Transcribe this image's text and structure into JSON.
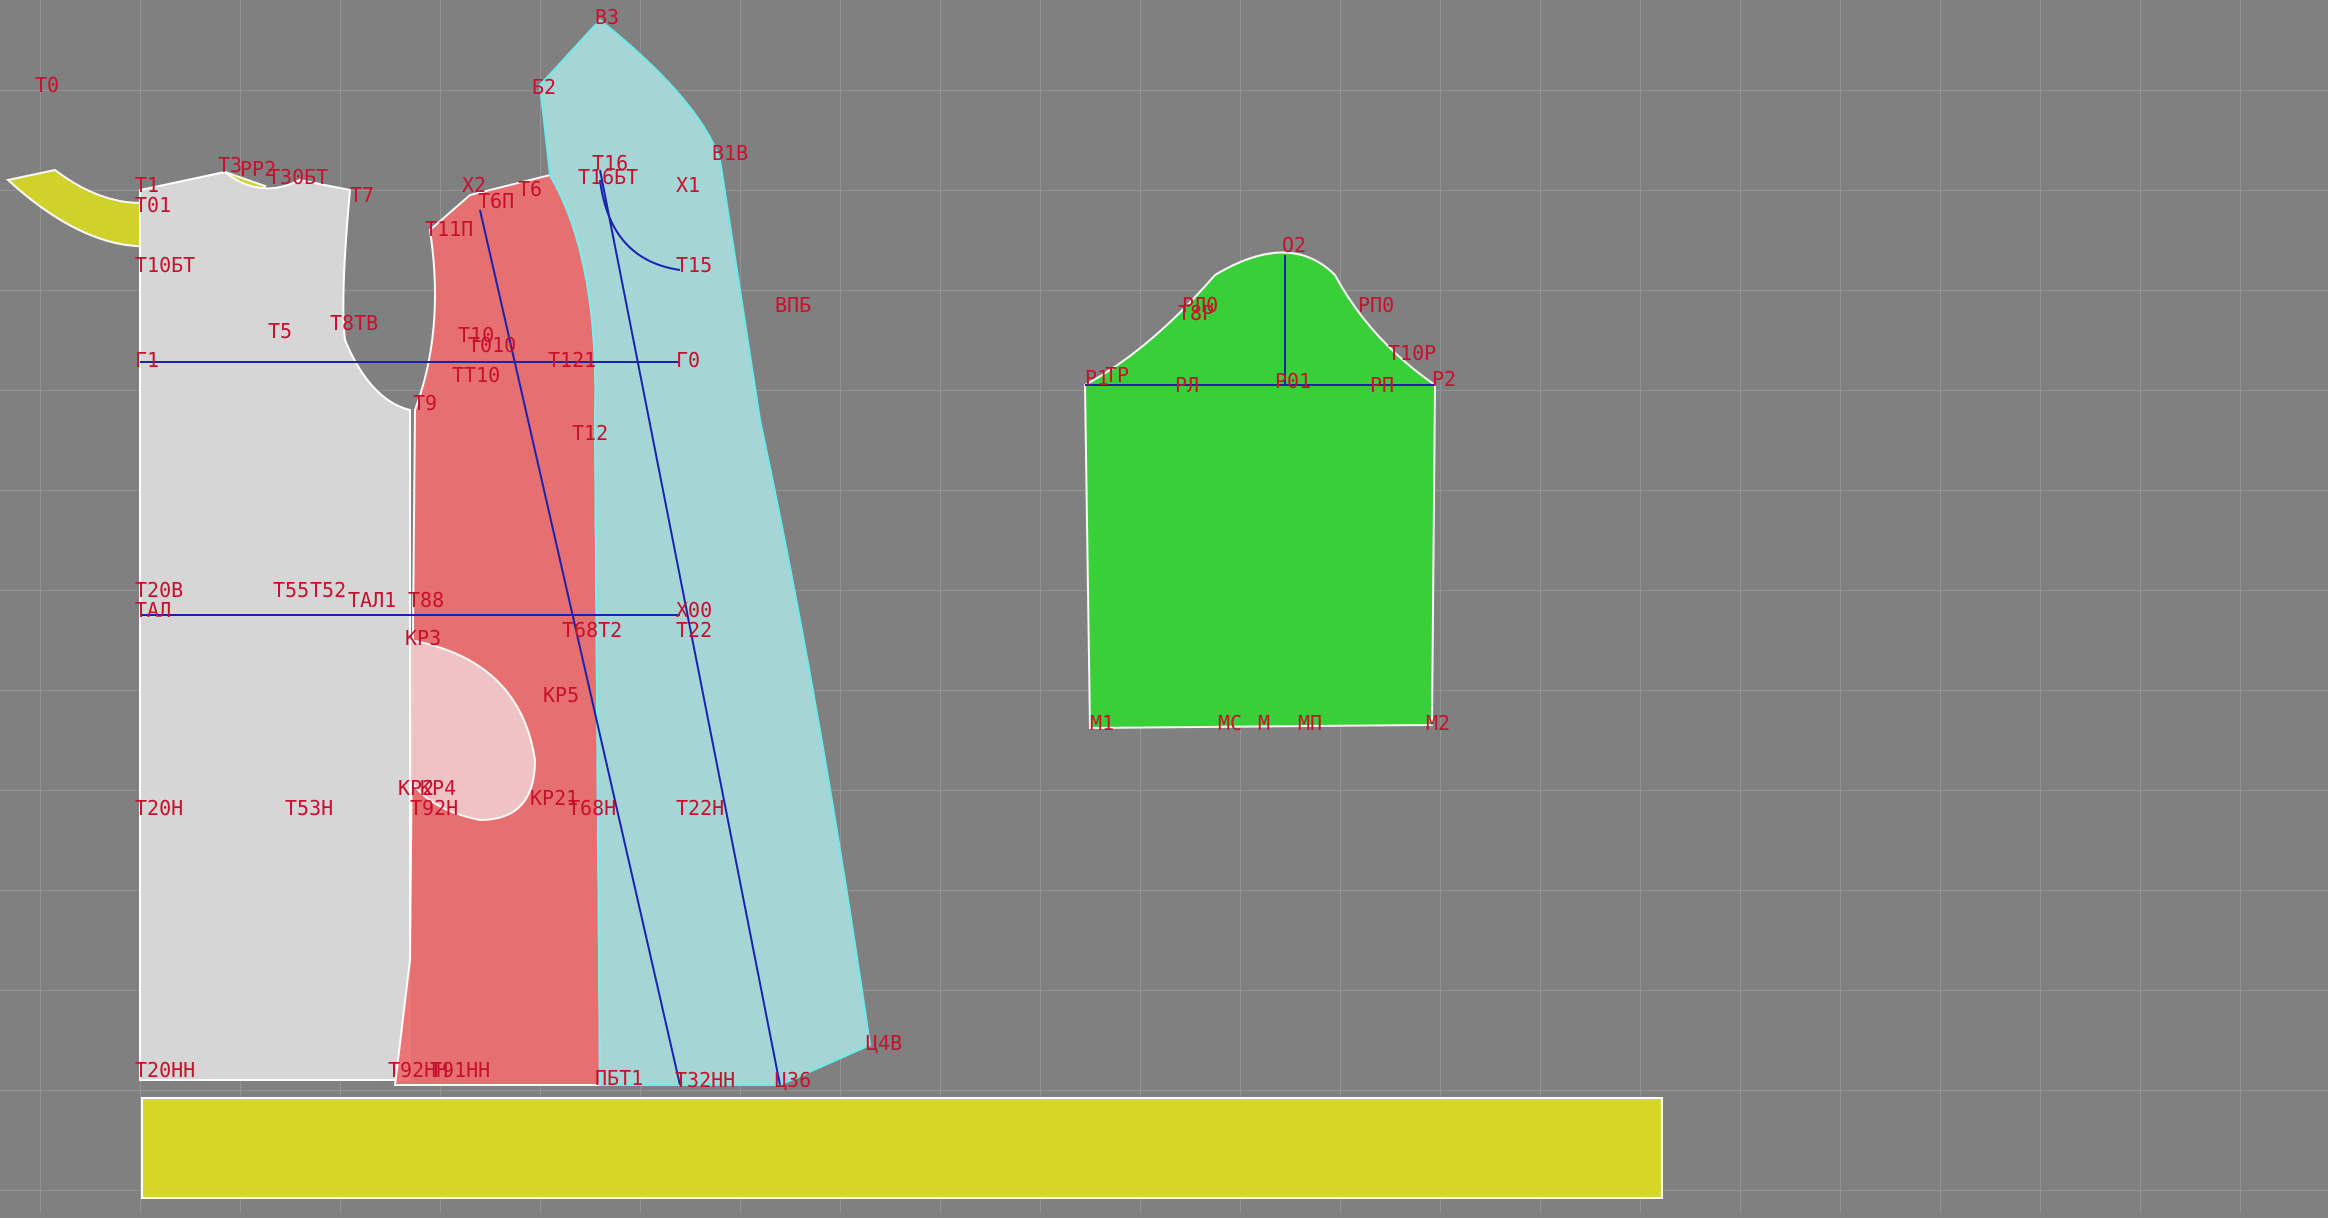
{
  "colors": {
    "background": "#808080",
    "grid": "#9a9a9a",
    "label": "#c8102e",
    "construction_line": "#1a22b0",
    "point": "#1a9a2a",
    "back_piece": "#d6d6d6",
    "side_piece": "#ec7070",
    "front_piece": "#a8dada",
    "sleeve": "#36d436",
    "collar": "#d6d628",
    "band": "#d6d628"
  },
  "pieces": {
    "collar": "collar",
    "back": "back",
    "side_front": "side-front",
    "front": "front",
    "pocket": "pocket",
    "sleeve": "sleeve",
    "band": "band"
  },
  "labels": [
    "Т0",
    "Т1",
    "Т01",
    "Т3",
    "РР2",
    "Т30БТ",
    "Т7",
    "Т10БТ",
    "Т5",
    "Т8ТВ",
    "Г1",
    "Т20В",
    "ТАЛ",
    "Т55",
    "Т52",
    "ТАЛ1",
    "Т88",
    "КР3",
    "КР2",
    "КР4",
    "Т20Н",
    "Т53Н",
    "Т92Н",
    "Т20НН",
    "Т92НН",
    "Т91НН",
    "В3",
    "Б2",
    "В1В",
    "Т16",
    "Т16БТ",
    "Х1",
    "Х2",
    "Т6П",
    "Т6",
    "Т11П",
    "Т15",
    "ВПБ",
    "Т10",
    "Т010",
    "Т121",
    "Г0",
    "ТТ10",
    "Т9",
    "Т12",
    "Х00",
    "Т22",
    "КР5",
    "Т68Т2",
    "КР21",
    "Т68Н",
    "Т22Н",
    "Ц4В",
    "ПБТ1",
    "Т32НН",
    "Ц36",
    "О2",
    "Т8Р",
    "РЛ0",
    "РП0",
    "Т10Р",
    "Р1",
    "ТР",
    "РЛ",
    "Р01",
    "РП",
    "Р2",
    "М1",
    "МС",
    "М",
    "МП",
    "М2"
  ]
}
